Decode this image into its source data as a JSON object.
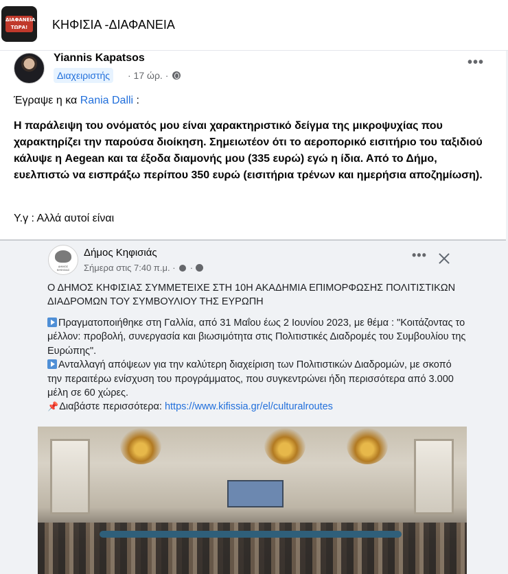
{
  "group": {
    "logo_text": "ΔΙΑΦΑΝΕΙΑ ΤΩΡΑ!",
    "title": "ΚΗΦΙΣΙΑ -ΔΙΑΦΑΝΕΙΑ"
  },
  "post": {
    "author": "Yiannis Kapatsos",
    "badge": "Διαχειριστής",
    "time": "· 17 ώρ. ·",
    "more_label": "•••",
    "intro_prefix": "Έγραψε η κα ",
    "intro_link": "Rania Dalli",
    "intro_suffix": " :",
    "bold_text": "Η παράλειψη του ονόματός μου είναι χαρακτηριστικό δείγμα της μικροψυχίας που χαρακτηρίζει την παρούσα διοίκηση. Σημειωτέον ότι το αεροπορικό εισιτήριο του ταξιδιού κάλυψε η Aegean και τα έξοδα διαμονής μου (335 ευρώ) εγώ η ίδια. Από το Δήμο, ευελπιστώ να εισπράξω περίπου 350 ευρώ (εισιτήρια τρένων και ημερήσια αποζημίωση).",
    "ps": "Υ.γ : Αλλά αυτοί είναι"
  },
  "shared": {
    "avatar_caption": "ΔΗΜΟΣ ΚΗΦΙΣΙΑΣ",
    "page_name": "Δήμος Κηφισιάς",
    "page_time": "Σήμερα στις 7:40 π.μ. ·",
    "more_label": "•••",
    "heading": "Ο ΔΗΜΟΣ ΚΗΦΙΣΙΑΣ ΣΥΜΜΕΤΕΙΧΕ ΣΤΗ 10Η ΑΚΑΔΗΜΙΑ ΕΠΙΜΟΡΦΩΣΗΣ ΠΟΛΙΤΙΣΤΙΚΩΝ ΔΙΑΔΡΟΜΩΝ ΤΟΥ ΣΥΜΒΟΥΛΙΟΥ ΤΗΣ ΕΥΡΩΠΗ",
    "para1": "Πραγματοποιήθηκε στη Γαλλία, από 31 Μαΐου έως 2 Ιουνίου 2023, με θέμα : \"Κοιτάζοντας το μέλλον: προβολή, συνεργασία και βιωσιμότητα στις Πολιτιστικές Διαδρομές του Συμβουλίου της Ευρώπης\".",
    "para2": "Ανταλλαγή απόψεων για την καλύτερη διαχείριση των Πολιτιστικών Διαδρομών, με σκοπό την περαιτέρω ενίσχυση του προγράμματος, που συγκεντρώνει ήδη περισσότερα από 3.000 μέλη σε 60 χώρες.",
    "read_more_label": "Διαβάστε περισσότερα: ",
    "read_more_link": "https://www.kifissia.gr/el/culturalroutes"
  },
  "icons": {
    "globe": "globe-icon",
    "more": "more-options-icon",
    "close": "close-icon",
    "play": "play-button-emoji-icon",
    "pin": "pushpin-emoji-icon"
  },
  "colors": {
    "link": "#216fdb",
    "badge_bg": "#e7f3ff",
    "page_bg": "#f0f2f5"
  }
}
